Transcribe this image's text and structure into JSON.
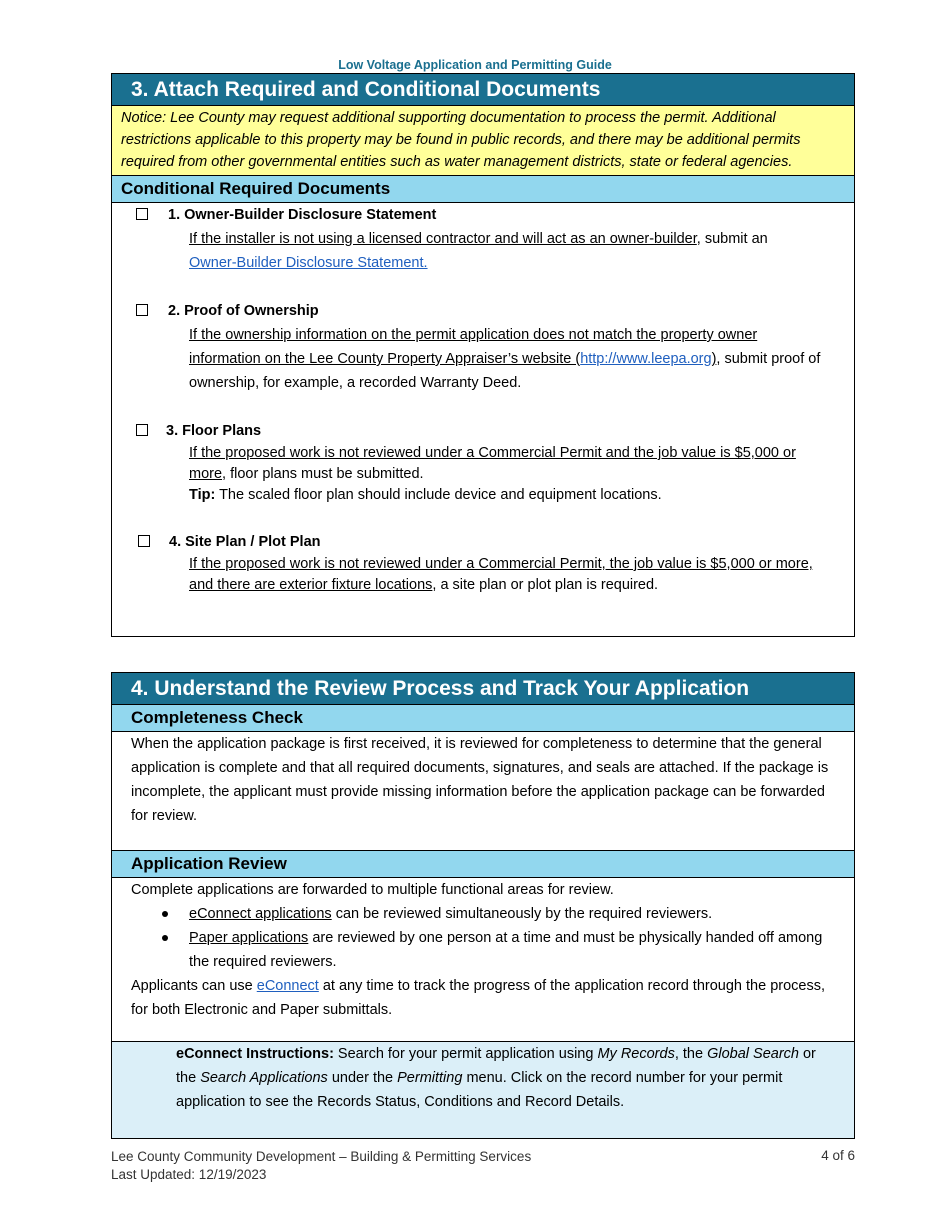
{
  "running_head": "Low Voltage Application and Permitting Guide",
  "section3": {
    "title": "3. Attach Required and Conditional Documents",
    "notice": "Notice: Lee County may request additional supporting documentation to process the permit. Additional restrictions applicable to this property may be found in public records, and there may be additional permits required from other governmental entities such as water management districts, state or federal agencies.",
    "subheading": "Conditional Required Documents",
    "items": [
      {
        "title": "1. Owner-Builder Disclosure Statement",
        "condition": "If the installer is not using a licensed contractor and will act as an owner-builder",
        "text": ", submit an ",
        "link": "Owner-Builder Disclosure Statement."
      },
      {
        "title": "2. Proof of Ownership",
        "condition": "If the ownership information on the permit application does not match the property owner information on the Lee County Property Appraiser’s website (",
        "link": "http://www.leepa.org",
        "condition_end": ")",
        "text": ", submit proof of ownership, for example, a recorded Warranty Deed."
      },
      {
        "title": "3. Floor Plans",
        "condition": "If the proposed work is not reviewed under a Commercial Permit and the job value is $5,000 or more",
        "text": ", floor plans must be submitted.",
        "tip_label": "Tip:",
        "tip": " The scaled floor plan should include device and equipment locations."
      },
      {
        "title": "4. Site Plan / Plot Plan",
        "condition": "If the proposed work is not reviewed under a Commercial Permit, the job value is $5,000 or more, and there are exterior fixture locations",
        "text": ", a site plan or plot plan is required."
      }
    ]
  },
  "section4": {
    "title": "4. Understand the Review Process and Track Your Application",
    "completeness": {
      "heading": "Completeness Check",
      "text": "When the application package is first received, it is reviewed for completeness to determine that the general application is complete and that all required documents, signatures, and seals are attached. If the package is incomplete, the applicant must provide missing information before the application package can be forwarded for review."
    },
    "review": {
      "heading": "Application Review",
      "intro": "Complete applications are forwarded to multiple functional areas for review.",
      "bullets": [
        {
          "lead": "eConnect applications",
          "text": " can be reviewed simultaneously by the required reviewers."
        },
        {
          "lead": "Paper applications",
          "text": " are reviewed by one person at a time and must be physically handed off among the required reviewers."
        }
      ],
      "track_pre": "Applicants can use ",
      "track_link": "eConnect",
      "track_post": " at any time to track the progress of the application record through the process, for both Electronic and Paper submittals."
    },
    "instructions": {
      "label": "eConnect Instructions:",
      "t1": " Search for your permit application using ",
      "i1": "My Records",
      "t2": ", the ",
      "i2": "Global Search",
      "t3": " or the ",
      "i3": "Search Applications",
      "t4": " under the ",
      "i4": "Permitting",
      "t5": " menu. Click on the record number for your permit application to see the Records Status, Conditions and Record Details."
    }
  },
  "footer": {
    "org": "Lee County Community Development – Building & Permitting Services",
    "updated": "Last Updated: 12/19/2023",
    "page": "4 of 6"
  }
}
